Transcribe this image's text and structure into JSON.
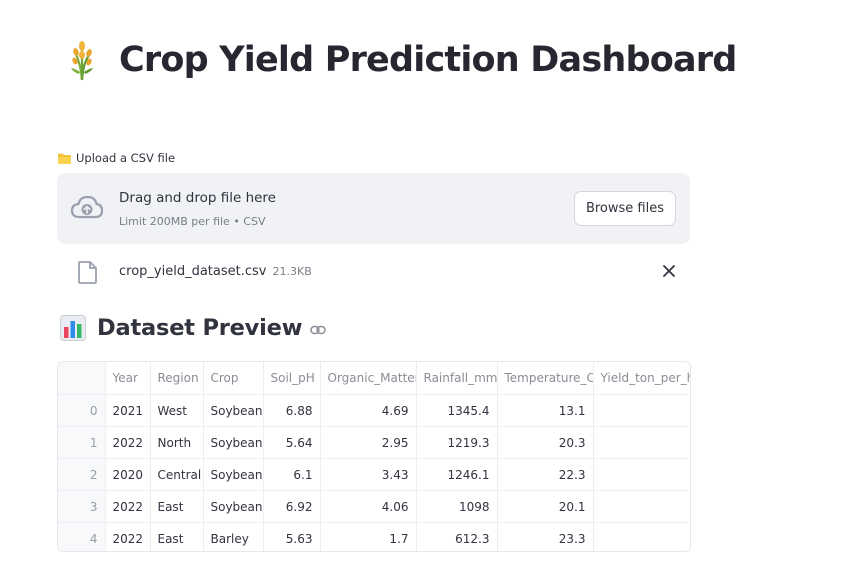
{
  "page": {
    "title": "Crop Yield Prediction Dashboard",
    "title_icon": "sheaf-of-rice-icon"
  },
  "uploader": {
    "label": "Upload a CSV file",
    "label_icon": "folder-icon",
    "drop_text": "Drag and drop file here",
    "limit_text": "Limit 200MB per file • CSV",
    "browse_label": "Browse files",
    "file": {
      "name": "crop_yield_dataset.csv",
      "size": "21.3KB"
    }
  },
  "preview": {
    "title": "Dataset Preview",
    "title_icon": "bar-chart-icon",
    "columns": [
      "Year",
      "Region",
      "Crop",
      "Soil_pH",
      "Organic_Matter",
      "Rainfall_mm",
      "Temperature_C",
      "Yield_ton_per_he"
    ],
    "rows": [
      {
        "index": "0",
        "cells": [
          "2021",
          "West",
          "Soybean",
          "6.88",
          "4.69",
          "1345.4",
          "13.1",
          ""
        ]
      },
      {
        "index": "1",
        "cells": [
          "2022",
          "North",
          "Soybean",
          "5.64",
          "2.95",
          "1219.3",
          "20.3",
          ""
        ]
      },
      {
        "index": "2",
        "cells": [
          "2020",
          "Central",
          "Soybean",
          "6.1",
          "3.43",
          "1246.1",
          "22.3",
          ""
        ]
      },
      {
        "index": "3",
        "cells": [
          "2022",
          "East",
          "Soybean",
          "6.92",
          "4.06",
          "1098",
          "20.1",
          ""
        ]
      },
      {
        "index": "4",
        "cells": [
          "2022",
          "East",
          "Barley",
          "5.63",
          "1.7",
          "612.3",
          "23.3",
          ""
        ]
      }
    ]
  },
  "colors": {
    "dropzone_bg": "#f0f2f6",
    "text": "#31333f",
    "muted": "#7b7d87"
  }
}
